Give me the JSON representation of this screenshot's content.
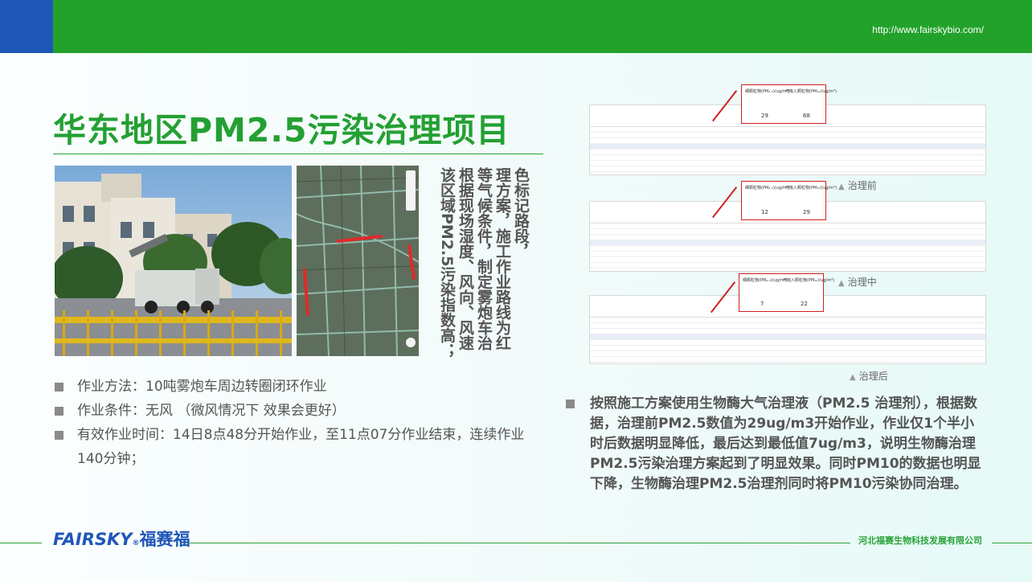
{
  "header": {
    "url": "http://www.fairskybio.com/"
  },
  "title": "华东地区PM2.5污染治理项目",
  "vertical_text": [
    "色标记路段，",
    "理方案，施工作业路线为红",
    "等气候条件，制定雾炮车治",
    "根据现场湿度、风向、风速",
    "该区域PM2.5污染指数高；"
  ],
  "bullets": [
    "作业方法：10吨雾炮车周边转圈闭环作业",
    "作业条件：无风 （微风情况下 效果会更好）",
    "有效作业时间：14日8点48分开始作业，至11点07分作业结束，连续作业140分钟；"
  ],
  "tables": [
    {
      "caption": "治理前",
      "pm25_label": "细颗粒物(PM₂.₅)(ug/m³)",
      "pm10_label": "可吸入颗粒物(PM₁₀)(ug/m³)",
      "pm25": "29",
      "pm10": "68"
    },
    {
      "caption": "治理中",
      "pm25_label": "细颗粒物(PM₂.₅)(ug/m³)",
      "pm10_label": "可吸入颗粒物(PM₁₀)(ug/m³)",
      "pm25": "12",
      "pm10": "29"
    },
    {
      "caption": "治理后",
      "pm25_label": "细颗粒物(PM₂.₅)(ug/m³)",
      "pm10_label": "可吸入颗粒物(PM₁₀)(ug/m³)",
      "pm25": "7",
      "pm10": "22"
    }
  ],
  "conclusion": "按照施工方案使用生物酶大气治理液（PM2.5 治理剂），根据数据，治理前PM2.5数值为29ug/m3开始作业，作业仅1个半小时后数据明显降低，最后达到最低值7ug/m3，说明生物酶治理PM2.5污染治理方案起到了明显效果。同时PM10的数据也明显下降，生物酶治理PM2.5治理剂同时将PM10污染协同治理。",
  "footer": {
    "logo_en": "FAIRSKY",
    "logo_cn": "福赛福",
    "company": "河北福赛生物科技发展有限公司"
  },
  "colors": {
    "green": "#22a22b",
    "blue": "#1f57b8",
    "red": "#d21f1f"
  }
}
